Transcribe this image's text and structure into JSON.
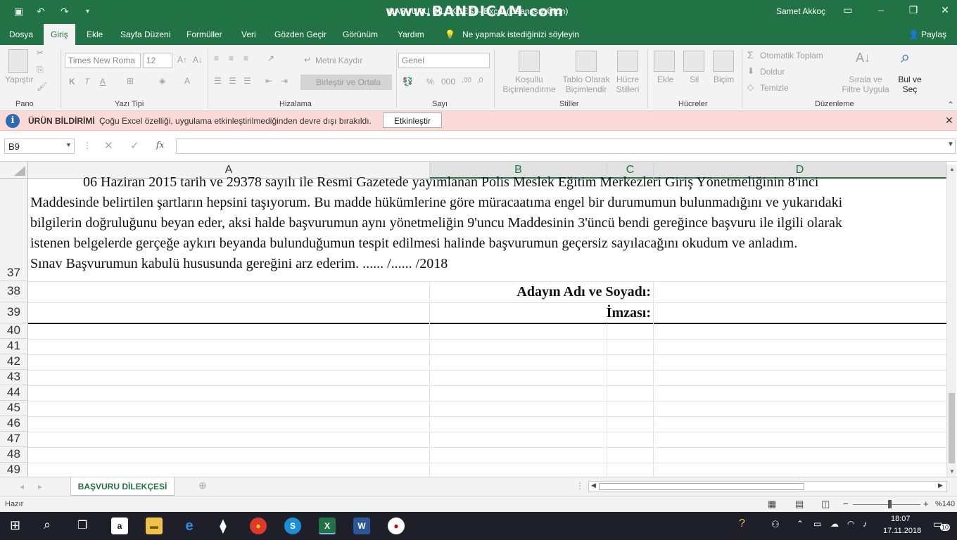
{
  "titlebar": {
    "title": "BAŞVURU DİLEKÇESİ - Excel (Lisanssız Ürün)",
    "watermark": "www.BANDICAM.com",
    "user": "Samet Akkoç"
  },
  "menu": {
    "tabs": [
      "Dosya",
      "Giriş",
      "Ekle",
      "Sayfa Düzeni",
      "Formüller",
      "Veri",
      "Gözden Geçir",
      "Görünüm",
      "Yardım"
    ],
    "tellme": "Ne yapmak istediğinizi söyleyin",
    "share": "Paylaş"
  },
  "ribbon": {
    "paste": "Yapıştır",
    "font_name": "Times New Roma",
    "font_size": "12",
    "wrap_text": "Metni Kaydır",
    "merge_center": "Birleştir ve Ortala",
    "number_format": "Genel",
    "cond_format": "Koşullu Biçimlendirme",
    "format_table": "Tablo Olarak Biçimlendir",
    "cell_styles": "Hücre Stilleri",
    "insert": "Ekle",
    "delete": "Sil",
    "format": "Biçim",
    "autosum": "Otomatik Toplam",
    "fill": "Doldur",
    "clear": "Temizle",
    "sort_filter": "Sırala ve Filtre Uygula",
    "find_select": "Bul ve Seç",
    "groups": {
      "clipboard": "Pano",
      "font": "Yazı Tipi",
      "alignment": "Hizalama",
      "number": "Sayı",
      "styles": "Stiller",
      "cells": "Hücreler",
      "editing": "Düzenleme"
    }
  },
  "notification": {
    "title": "ÜRÜN BİLDİRİMİ",
    "message": "Çoğu Excel özelliği, uygulama etkinleştirilmediğinden devre dışı bırakıldı.",
    "button": "Etkinleştir"
  },
  "formula_bar": {
    "name_box": "B9",
    "fx": "fx",
    "value": ""
  },
  "columns": [
    "A",
    "B",
    "C",
    "D"
  ],
  "rows": [
    "37",
    "38",
    "39",
    "40",
    "41",
    "42",
    "43",
    "44",
    "45",
    "46",
    "47",
    "48",
    "49"
  ],
  "document": {
    "lines": [
      "06 Haziran 2015 tarih ve 29378 sayılı ile Resmi Gazetede yayımlanan Polis Meslek Eğitim Merkezleri Giriş Yönetmeliğinin 8'inci",
      "Maddesinde belirtilen şartların hepsini taşıyorum. Bu madde hükümlerine göre müracaatıma engel bir durumumun bulunmadığını ve yukarıdaki",
      "bilgilerin doğruluğunu beyan eder, aksi halde başvurumun aynı yönetmeliğin 9'uncu Maddesinin 3'üncü bendi gereğince başvuru ile ilgili olarak",
      "istenen belgelerde gerçeğe aykırı beyanda bulunduğumun tespit edilmesi halinde başvurumun geçersiz sayılacağını okudum ve anladım.",
      "Sınav Başvurumun kabulü hususunda gereğini arz ederim.    ...... /...... /2018"
    ],
    "name_label": "Adayın Adı ve Soyadı:",
    "signature_label": "İmzası:"
  },
  "sheet": {
    "tab": "BAŞVURU DİLEKÇESİ"
  },
  "status": {
    "ready": "Hazır",
    "zoom": "%140"
  },
  "taskbar": {
    "time": "18:07",
    "date": "17.11.2018",
    "notifications": "10"
  }
}
